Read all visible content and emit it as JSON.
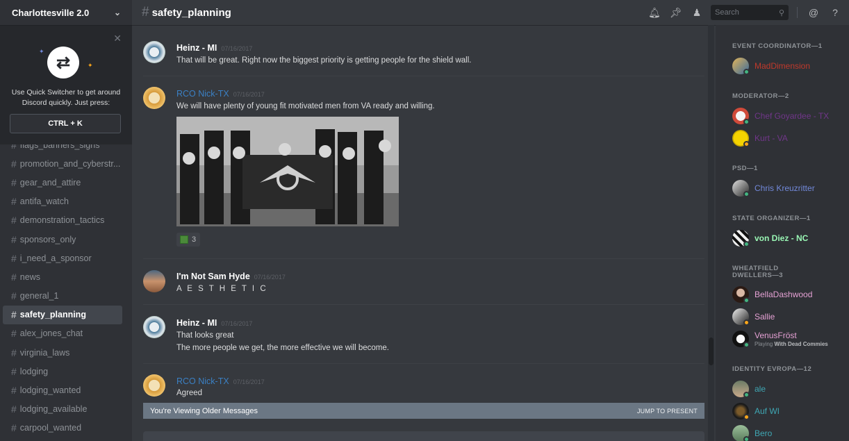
{
  "server": {
    "name": "Charlottesville 2.0"
  },
  "quick_switcher": {
    "text": "Use Quick Switcher to get around Discord quickly. Just press:",
    "key": "CTRL + K"
  },
  "channels": [
    {
      "name": "flags_banners_signs"
    },
    {
      "name": "promotion_and_cyberstr..."
    },
    {
      "name": "gear_and_attire"
    },
    {
      "name": "antifa_watch"
    },
    {
      "name": "demonstration_tactics"
    },
    {
      "name": "sponsors_only"
    },
    {
      "name": "i_need_a_sponsor"
    },
    {
      "name": "news"
    },
    {
      "name": "general_1"
    },
    {
      "name": "safety_planning"
    },
    {
      "name": "alex_jones_chat"
    },
    {
      "name": "virginia_laws"
    },
    {
      "name": "lodging"
    },
    {
      "name": "lodging_wanted"
    },
    {
      "name": "lodging_available"
    },
    {
      "name": "carpool_wanted"
    }
  ],
  "header": {
    "hash": "#",
    "channel": "safety_planning",
    "search_placeholder": "Search"
  },
  "messages": [
    {
      "author": "Heinz - MI",
      "timestamp": "07/16/2017",
      "lines": [
        "That will be great. Right now the biggest priority is getting people for the shield wall."
      ]
    },
    {
      "author": "RCO Nick-TX",
      "timestamp": "07/16/2017",
      "lines": [
        "We will have plenty of young fit motivated men from VA ready and willing."
      ],
      "reaction_count": "3"
    },
    {
      "author": "I'm Not Sam Hyde",
      "timestamp": "07/16/2017",
      "lines": [
        "A E S T H E T I C"
      ]
    },
    {
      "author": "Heinz - MI",
      "timestamp": "07/16/2017",
      "lines": [
        "That looks great",
        "The more people we get, the more effective we will become."
      ]
    },
    {
      "author": "RCO Nick-TX",
      "timestamp": "07/16/2017",
      "lines": [
        "Agreed"
      ]
    }
  ],
  "older_bar": {
    "label": "You're Viewing Older Messages",
    "jump": "JUMP TO PRESENT"
  },
  "members": {
    "roles": [
      {
        "title": "EVENT COORDINATOR—1",
        "members": [
          {
            "name": "MadDimension",
            "color": "#c0392b",
            "status": "online"
          }
        ]
      },
      {
        "title": "MODERATOR—2",
        "members": [
          {
            "name": "Chef Goyardee - TX",
            "color": "#71368a",
            "status": "online"
          },
          {
            "name": "Kurt - VA",
            "color": "#71368a",
            "status": "idle"
          }
        ]
      },
      {
        "title": "PSD—1",
        "members": [
          {
            "name": "Chris Kreuzritter",
            "color": "#7289da",
            "status": "online"
          }
        ]
      },
      {
        "title": "STATE ORGANIZER—1",
        "members": [
          {
            "name": "von Diez - NC",
            "color": "#99f6b4",
            "status": "online"
          }
        ]
      },
      {
        "title_lines": [
          "WHEATFIELD",
          "DWELLERS—3"
        ],
        "members": [
          {
            "name": "BellaDashwood",
            "color": "#e5a1d4",
            "status": "online"
          },
          {
            "name": "Sallie",
            "color": "#e5a1d4",
            "status": "idle"
          },
          {
            "name": "VenusFröst",
            "color": "#e5a1d4",
            "status": "online",
            "activity_prefix": "Playing ",
            "activity_game": "With Dead Commies"
          }
        ]
      },
      {
        "title": "IDENTITY EVROPA—12",
        "members": [
          {
            "name": "ale",
            "color": "#3fa7b4",
            "status": "online"
          },
          {
            "name": "Auf WI",
            "color": "#3fa7b4",
            "status": "idle"
          },
          {
            "name": "Bero",
            "color": "#3fa7b4",
            "status": "online"
          }
        ]
      }
    ]
  }
}
